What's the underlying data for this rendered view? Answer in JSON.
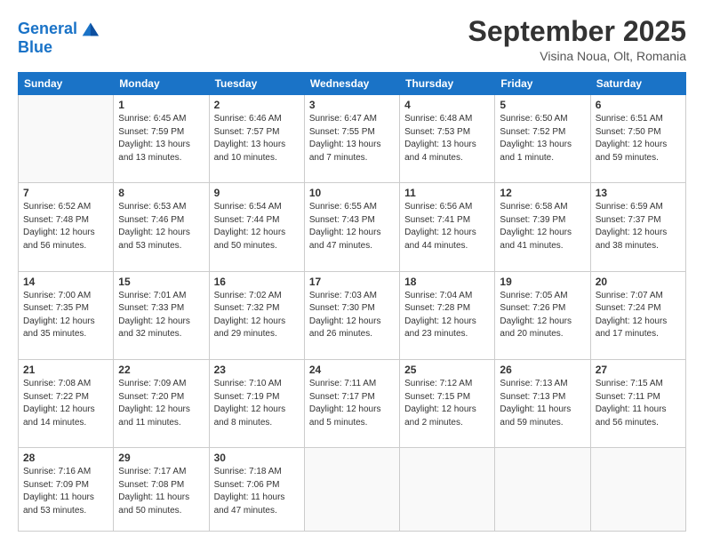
{
  "header": {
    "logo_line1": "General",
    "logo_line2": "Blue",
    "month": "September 2025",
    "location": "Visina Noua, Olt, Romania"
  },
  "weekdays": [
    "Sunday",
    "Monday",
    "Tuesday",
    "Wednesday",
    "Thursday",
    "Friday",
    "Saturday"
  ],
  "weeks": [
    [
      {
        "day": "",
        "info": ""
      },
      {
        "day": "1",
        "info": "Sunrise: 6:45 AM\nSunset: 7:59 PM\nDaylight: 13 hours\nand 13 minutes."
      },
      {
        "day": "2",
        "info": "Sunrise: 6:46 AM\nSunset: 7:57 PM\nDaylight: 13 hours\nand 10 minutes."
      },
      {
        "day": "3",
        "info": "Sunrise: 6:47 AM\nSunset: 7:55 PM\nDaylight: 13 hours\nand 7 minutes."
      },
      {
        "day": "4",
        "info": "Sunrise: 6:48 AM\nSunset: 7:53 PM\nDaylight: 13 hours\nand 4 minutes."
      },
      {
        "day": "5",
        "info": "Sunrise: 6:50 AM\nSunset: 7:52 PM\nDaylight: 13 hours\nand 1 minute."
      },
      {
        "day": "6",
        "info": "Sunrise: 6:51 AM\nSunset: 7:50 PM\nDaylight: 12 hours\nand 59 minutes."
      }
    ],
    [
      {
        "day": "7",
        "info": "Sunrise: 6:52 AM\nSunset: 7:48 PM\nDaylight: 12 hours\nand 56 minutes."
      },
      {
        "day": "8",
        "info": "Sunrise: 6:53 AM\nSunset: 7:46 PM\nDaylight: 12 hours\nand 53 minutes."
      },
      {
        "day": "9",
        "info": "Sunrise: 6:54 AM\nSunset: 7:44 PM\nDaylight: 12 hours\nand 50 minutes."
      },
      {
        "day": "10",
        "info": "Sunrise: 6:55 AM\nSunset: 7:43 PM\nDaylight: 12 hours\nand 47 minutes."
      },
      {
        "day": "11",
        "info": "Sunrise: 6:56 AM\nSunset: 7:41 PM\nDaylight: 12 hours\nand 44 minutes."
      },
      {
        "day": "12",
        "info": "Sunrise: 6:58 AM\nSunset: 7:39 PM\nDaylight: 12 hours\nand 41 minutes."
      },
      {
        "day": "13",
        "info": "Sunrise: 6:59 AM\nSunset: 7:37 PM\nDaylight: 12 hours\nand 38 minutes."
      }
    ],
    [
      {
        "day": "14",
        "info": "Sunrise: 7:00 AM\nSunset: 7:35 PM\nDaylight: 12 hours\nand 35 minutes."
      },
      {
        "day": "15",
        "info": "Sunrise: 7:01 AM\nSunset: 7:33 PM\nDaylight: 12 hours\nand 32 minutes."
      },
      {
        "day": "16",
        "info": "Sunrise: 7:02 AM\nSunset: 7:32 PM\nDaylight: 12 hours\nand 29 minutes."
      },
      {
        "day": "17",
        "info": "Sunrise: 7:03 AM\nSunset: 7:30 PM\nDaylight: 12 hours\nand 26 minutes."
      },
      {
        "day": "18",
        "info": "Sunrise: 7:04 AM\nSunset: 7:28 PM\nDaylight: 12 hours\nand 23 minutes."
      },
      {
        "day": "19",
        "info": "Sunrise: 7:05 AM\nSunset: 7:26 PM\nDaylight: 12 hours\nand 20 minutes."
      },
      {
        "day": "20",
        "info": "Sunrise: 7:07 AM\nSunset: 7:24 PM\nDaylight: 12 hours\nand 17 minutes."
      }
    ],
    [
      {
        "day": "21",
        "info": "Sunrise: 7:08 AM\nSunset: 7:22 PM\nDaylight: 12 hours\nand 14 minutes."
      },
      {
        "day": "22",
        "info": "Sunrise: 7:09 AM\nSunset: 7:20 PM\nDaylight: 12 hours\nand 11 minutes."
      },
      {
        "day": "23",
        "info": "Sunrise: 7:10 AM\nSunset: 7:19 PM\nDaylight: 12 hours\nand 8 minutes."
      },
      {
        "day": "24",
        "info": "Sunrise: 7:11 AM\nSunset: 7:17 PM\nDaylight: 12 hours\nand 5 minutes."
      },
      {
        "day": "25",
        "info": "Sunrise: 7:12 AM\nSunset: 7:15 PM\nDaylight: 12 hours\nand 2 minutes."
      },
      {
        "day": "26",
        "info": "Sunrise: 7:13 AM\nSunset: 7:13 PM\nDaylight: 11 hours\nand 59 minutes."
      },
      {
        "day": "27",
        "info": "Sunrise: 7:15 AM\nSunset: 7:11 PM\nDaylight: 11 hours\nand 56 minutes."
      }
    ],
    [
      {
        "day": "28",
        "info": "Sunrise: 7:16 AM\nSunset: 7:09 PM\nDaylight: 11 hours\nand 53 minutes."
      },
      {
        "day": "29",
        "info": "Sunrise: 7:17 AM\nSunset: 7:08 PM\nDaylight: 11 hours\nand 50 minutes."
      },
      {
        "day": "30",
        "info": "Sunrise: 7:18 AM\nSunset: 7:06 PM\nDaylight: 11 hours\nand 47 minutes."
      },
      {
        "day": "",
        "info": ""
      },
      {
        "day": "",
        "info": ""
      },
      {
        "day": "",
        "info": ""
      },
      {
        "day": "",
        "info": ""
      }
    ]
  ]
}
